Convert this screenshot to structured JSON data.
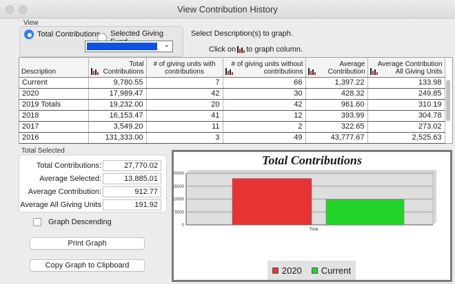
{
  "window": {
    "title": "View Contribution History"
  },
  "view": {
    "group_label": "View",
    "radio_total": "Total Contributions",
    "radio_fund": "Selected Giving Fund",
    "selected_radio": "total"
  },
  "hints": {
    "select_text": "Select Description(s) to graph.",
    "click_prefix": "Click on",
    "click_suffix": " to graph column."
  },
  "table": {
    "columns": [
      {
        "label": "Description",
        "graphable": false
      },
      {
        "label": "Total Contributions",
        "graphable": true
      },
      {
        "label": "# of giving units with contributions",
        "graphable": false
      },
      {
        "label": "# of giving units without contributions",
        "graphable": true
      },
      {
        "label": "Average Contribution",
        "graphable": true
      },
      {
        "label": "Average Contribution All Giving Units",
        "graphable": true
      }
    ],
    "rows": [
      [
        "Current",
        "9,780.55",
        "7",
        "66",
        "1,397.22",
        "133.98"
      ],
      [
        "2020",
        "17,989.47",
        "42",
        "30",
        "428.32",
        "249.85"
      ],
      [
        "2019 Totals",
        "19,232.00",
        "20",
        "42",
        "961.60",
        "310.19"
      ],
      [
        "2018",
        "16,153.47",
        "41",
        "12",
        "393.99",
        "304.78"
      ],
      [
        "2017",
        "3,549.20",
        "11",
        "2",
        "322.65",
        "273.02"
      ],
      [
        "2016",
        "131,333.00",
        "3",
        "49",
        "43,777.67",
        "2,525.63"
      ]
    ]
  },
  "totals": {
    "section_label": "Total Selected",
    "items": [
      {
        "label": "Total Contributions:",
        "value": "27,770.02"
      },
      {
        "label": "Average Selected:",
        "value": "13,885.01"
      },
      {
        "label": "Average Contribution:",
        "value": "912.77"
      },
      {
        "label": "Average All Giving Units",
        "value": "191.92"
      }
    ]
  },
  "controls": {
    "graph_descending": "Graph Descending",
    "print_graph": "Print Graph",
    "copy_graph": "Copy Graph to Clipboard"
  },
  "chart_data": {
    "type": "bar",
    "title": "Total Contributions",
    "categories": [
      "Total"
    ],
    "series": [
      {
        "name": "2020",
        "values": [
          17989.47
        ],
        "color": "#e63434"
      },
      {
        "name": "Current",
        "values": [
          9780.55
        ],
        "color": "#25d42a"
      }
    ],
    "ylim": [
      0,
      20000
    ],
    "yticks": [
      0,
      5000,
      10000,
      15000,
      20000
    ],
    "grid": true,
    "legend": "bottom"
  }
}
